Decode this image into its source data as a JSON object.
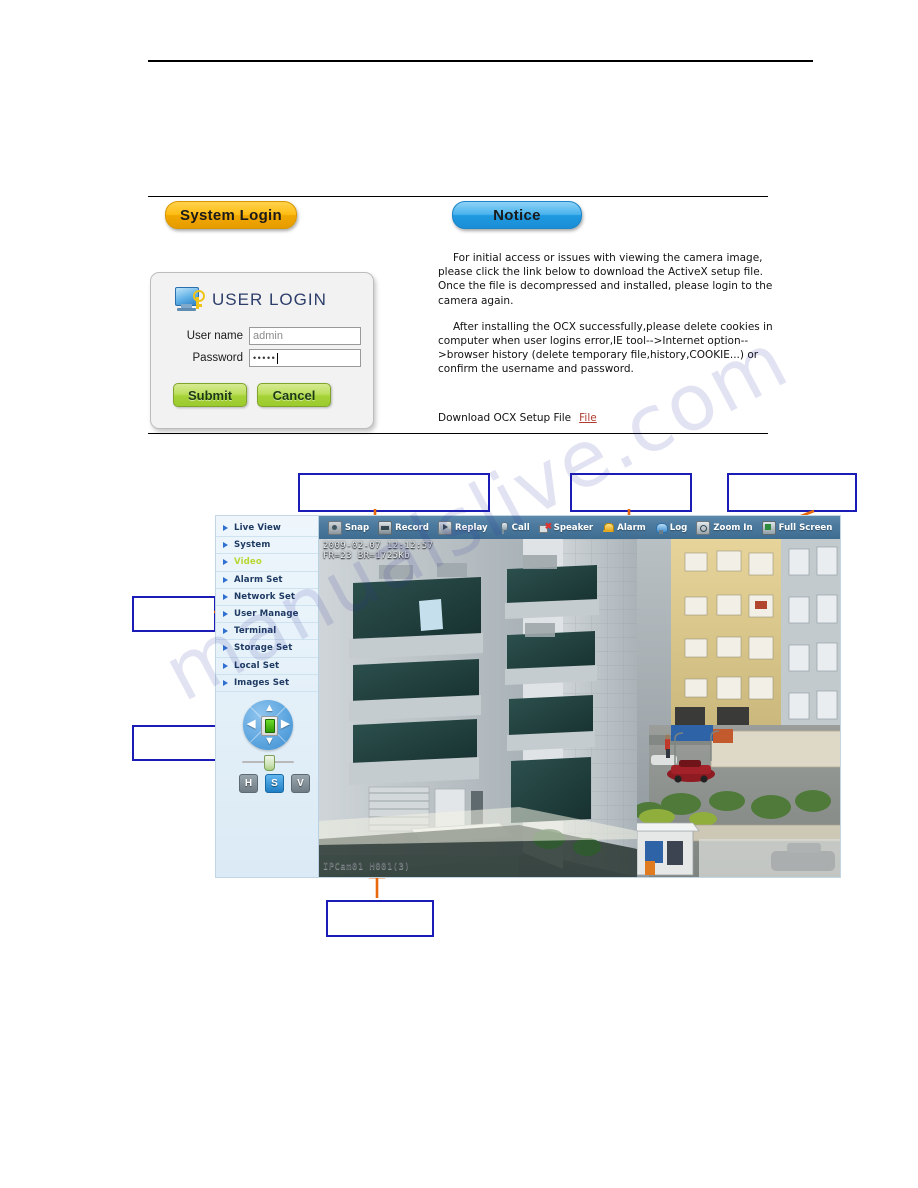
{
  "watermark": "manualslive.com",
  "sections": {
    "login_heading": "System Login",
    "notice_heading": "Notice"
  },
  "login_panel": {
    "title": "USER LOGIN",
    "icon": "monitor-key-icon",
    "username_label": "User name",
    "username_value": "admin",
    "username_placeholder": "admin",
    "password_label": "Password",
    "password_value": "•••••",
    "submit_label": "Submit",
    "cancel_label": "Cancel"
  },
  "notice": {
    "paragraph1": "For initial access or issues with viewing the camera image, please click the link below to download the ActiveX setup file. Once the file is decompressed and installed, please login to the camera again.",
    "paragraph2": "After installing the OCX successfully,please delete cookies in computer when user logins error,IE tool-->Internet option-->browser history (delete temporary file,history,COOKIE...) or confirm the username and password.",
    "download_label": "Download OCX Setup File",
    "download_link": "File"
  },
  "viewer": {
    "sidebar": {
      "items": [
        {
          "label": "Live View",
          "active": false
        },
        {
          "label": "System",
          "active": false
        },
        {
          "label": "Video",
          "active": true
        },
        {
          "label": "Alarm Set",
          "active": false
        },
        {
          "label": "Network Set",
          "active": false
        },
        {
          "label": "User Manage",
          "active": false
        },
        {
          "label": "Terminal",
          "active": false
        },
        {
          "label": "Storage Set",
          "active": false
        },
        {
          "label": "Local Set",
          "active": false
        },
        {
          "label": "Images Set",
          "active": false
        }
      ]
    },
    "ptz": {
      "up_icon": "chevron-up-icon",
      "down_icon": "chevron-down-icon",
      "left_icon": "chevron-left-icon",
      "right_icon": "chevron-right-icon",
      "center_icon": "ptz-home-icon",
      "buttons": [
        {
          "label": "H",
          "selected": false
        },
        {
          "label": "S",
          "selected": true
        },
        {
          "label": "V",
          "selected": false
        }
      ]
    },
    "toolbar": [
      {
        "label": "Snap",
        "icon": "snap-icon",
        "ico": "ico-snap"
      },
      {
        "label": "Record",
        "icon": "record-icon",
        "ico": "ico-record"
      },
      {
        "label": "Replay",
        "icon": "replay-icon",
        "ico": "ico-replay"
      },
      {
        "label": "Call",
        "icon": "call-icon",
        "ico": "ico-call"
      },
      {
        "label": "Speaker",
        "icon": "speaker-mute-icon",
        "ico": "ico-speaker"
      },
      {
        "label": "Alarm",
        "icon": "alarm-bell-icon",
        "ico": "ico-alarm"
      },
      {
        "label": "Log",
        "icon": "log-icon",
        "ico": "ico-log"
      },
      {
        "label": "Zoom In",
        "icon": "zoom-in-icon",
        "ico": "ico-zoomin"
      },
      {
        "label": "Full Screen",
        "icon": "full-screen-icon",
        "ico": "ico-fullscreen"
      }
    ],
    "osd": {
      "timestamp": "2009-02-07 12:12:57",
      "stats": "FR=23 BR=1725Kb",
      "camera_id": "IPCam01 H001(3)"
    }
  },
  "callouts": [
    {
      "id": 1,
      "text": ""
    },
    {
      "id": 2,
      "text": ""
    },
    {
      "id": 3,
      "text": ""
    },
    {
      "id": 4,
      "text": ""
    },
    {
      "id": 5,
      "text": ""
    },
    {
      "id": 6,
      "text": ""
    }
  ],
  "colors": {
    "callout_border": "#1b1bb5",
    "arrow": "#e8690b",
    "accent_yellow": "#ffbd14",
    "accent_blue": "#1f99e0",
    "active_menu": "#b9d733",
    "link": "#b03a2e"
  }
}
